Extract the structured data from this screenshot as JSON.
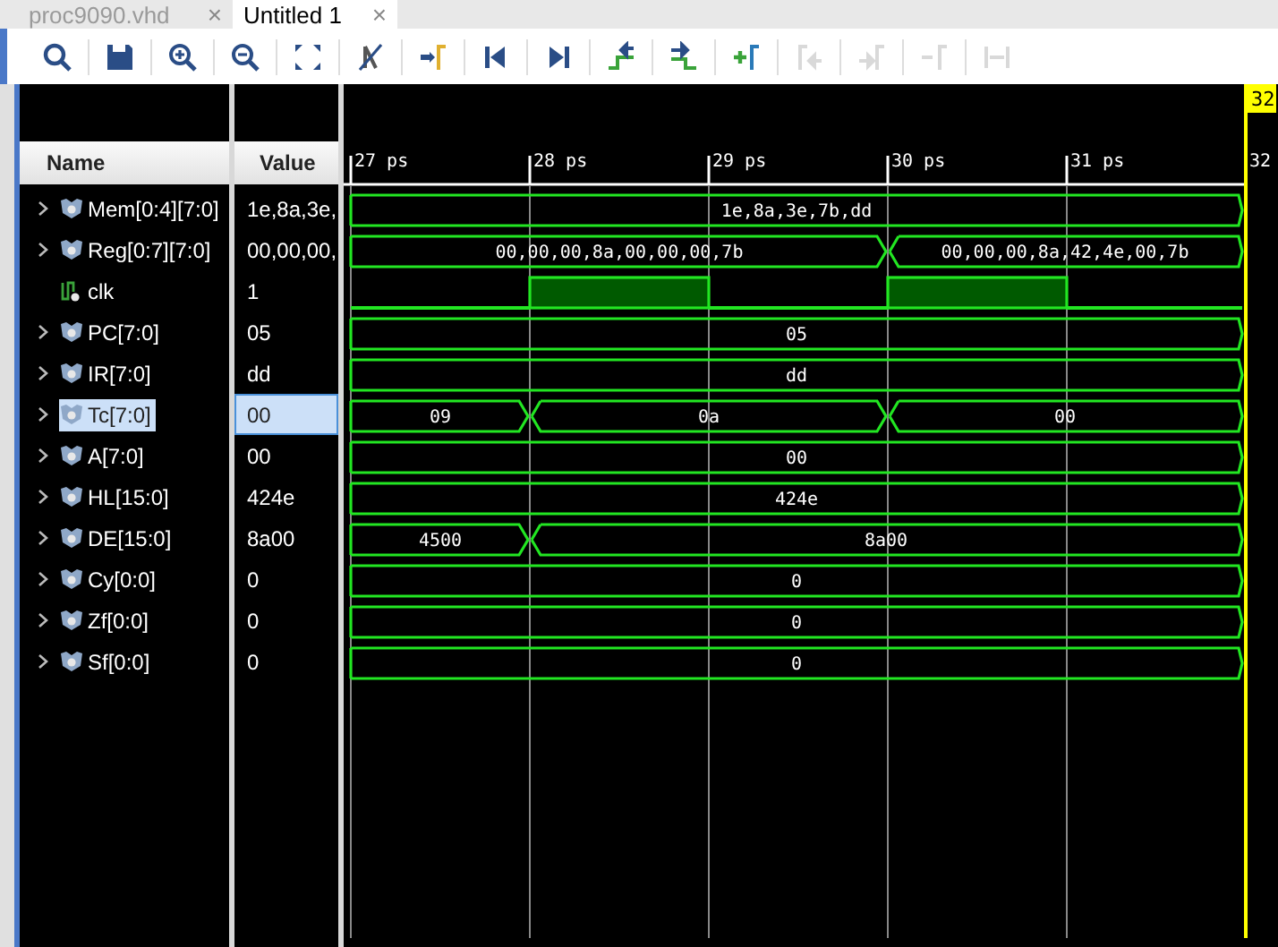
{
  "tabs": [
    {
      "label": "proc9090.vhd",
      "selected": false,
      "close": "×"
    },
    {
      "label": "Untitled 1",
      "selected": true,
      "close": "×"
    }
  ],
  "toolbar": [
    {
      "kind": "search",
      "disabled": false
    },
    {
      "kind": "save",
      "disabled": false
    },
    {
      "kind": "zoom-in",
      "disabled": false
    },
    {
      "kind": "zoom-out",
      "disabled": false
    },
    {
      "kind": "fit",
      "disabled": false
    },
    {
      "kind": "marker-off",
      "disabled": false
    },
    {
      "kind": "to-cursor",
      "disabled": false
    },
    {
      "kind": "go-start",
      "disabled": false
    },
    {
      "kind": "go-end",
      "disabled": false
    },
    {
      "kind": "prev-edge",
      "disabled": false
    },
    {
      "kind": "next-edge",
      "disabled": false
    },
    {
      "kind": "add-marker",
      "disabled": false
    },
    {
      "kind": "prev-marker",
      "disabled": true
    },
    {
      "kind": "next-marker",
      "disabled": true
    },
    {
      "kind": "remove-marker",
      "disabled": true
    },
    {
      "kind": "span",
      "disabled": true
    }
  ],
  "columns": {
    "name": "Name",
    "value": "Value"
  },
  "timeline": {
    "ticks": [
      "27 ps",
      "28 ps",
      "29 ps",
      "30 ps",
      "31 ps"
    ],
    "cursor": {
      "label": "32",
      "axis_label": "32"
    }
  },
  "signals": [
    {
      "name": "Mem[0:4][7:0]",
      "value": "1e,8a,3e,",
      "kind": "bus",
      "expandable": true,
      "selected": false,
      "steps": [
        {
          "change": false
        },
        {
          "change": false
        },
        {
          "change": false
        },
        {
          "change": false
        },
        {
          "change": false
        }
      ],
      "segments": [
        "1e,8a,3e,7b,dd"
      ]
    },
    {
      "name": "Reg[0:7][7:0]",
      "value": "00,00,00,",
      "kind": "bus",
      "expandable": true,
      "selected": false,
      "steps": [
        {
          "change": false
        },
        {
          "change": false
        },
        {
          "change": false
        },
        {
          "change": true
        },
        {
          "change": false
        }
      ],
      "segments": [
        "00,00,00,8a,00,00,00,7b",
        "00,00,00,8a,42,4e,00,7b"
      ]
    },
    {
      "name": "clk",
      "value": "1",
      "kind": "bit",
      "expandable": false,
      "selected": false,
      "steps": [
        {
          "high": false
        },
        {
          "high": true
        },
        {
          "high": false
        },
        {
          "high": true
        },
        {
          "high": false
        }
      ]
    },
    {
      "name": "PC[7:0]",
      "value": "05",
      "kind": "bus",
      "expandable": true,
      "selected": false,
      "steps": [
        {
          "change": false
        },
        {
          "change": false
        },
        {
          "change": false
        },
        {
          "change": false
        },
        {
          "change": false
        }
      ],
      "segments": [
        "05"
      ]
    },
    {
      "name": "IR[7:0]",
      "value": "dd",
      "kind": "bus",
      "expandable": true,
      "selected": false,
      "steps": [
        {
          "change": false
        },
        {
          "change": false
        },
        {
          "change": false
        },
        {
          "change": false
        },
        {
          "change": false
        }
      ],
      "segments": [
        "dd"
      ]
    },
    {
      "name": "Tc[7:0]",
      "value": "00",
      "kind": "bus",
      "expandable": true,
      "selected": true,
      "steps": [
        {
          "change": false
        },
        {
          "change": true
        },
        {
          "change": false
        },
        {
          "change": true
        },
        {
          "change": false
        }
      ],
      "segments": [
        "09",
        "0a",
        "00"
      ]
    },
    {
      "name": "A[7:0]",
      "value": "00",
      "kind": "bus",
      "expandable": true,
      "selected": false,
      "steps": [
        {
          "change": false
        },
        {
          "change": false
        },
        {
          "change": false
        },
        {
          "change": false
        },
        {
          "change": false
        }
      ],
      "segments": [
        "00"
      ]
    },
    {
      "name": "HL[15:0]",
      "value": "424e",
      "kind": "bus",
      "expandable": true,
      "selected": false,
      "steps": [
        {
          "change": false
        },
        {
          "change": false
        },
        {
          "change": false
        },
        {
          "change": false
        },
        {
          "change": false
        }
      ],
      "segments": [
        "424e"
      ]
    },
    {
      "name": "DE[15:0]",
      "value": "8a00",
      "kind": "bus",
      "expandable": true,
      "selected": false,
      "steps": [
        {
          "change": false
        },
        {
          "change": true
        },
        {
          "change": false
        },
        {
          "change": false
        },
        {
          "change": false
        }
      ],
      "segments": [
        "4500",
        "8a00"
      ]
    },
    {
      "name": "Cy[0:0]",
      "value": "0",
      "kind": "bus",
      "expandable": true,
      "selected": false,
      "steps": [
        {
          "change": false
        },
        {
          "change": false
        },
        {
          "change": false
        },
        {
          "change": false
        },
        {
          "change": false
        }
      ],
      "segments": [
        "0"
      ]
    },
    {
      "name": "Zf[0:0]",
      "value": "0",
      "kind": "bus",
      "expandable": true,
      "selected": false,
      "steps": [
        {
          "change": false
        },
        {
          "change": false
        },
        {
          "change": false
        },
        {
          "change": false
        },
        {
          "change": false
        }
      ],
      "segments": [
        "0"
      ]
    },
    {
      "name": "Sf[0:0]",
      "value": "0",
      "kind": "bus",
      "expandable": true,
      "selected": false,
      "steps": [
        {
          "change": false
        },
        {
          "change": false
        },
        {
          "change": false
        },
        {
          "change": false
        },
        {
          "change": false
        }
      ],
      "segments": [
        "0"
      ]
    }
  ]
}
